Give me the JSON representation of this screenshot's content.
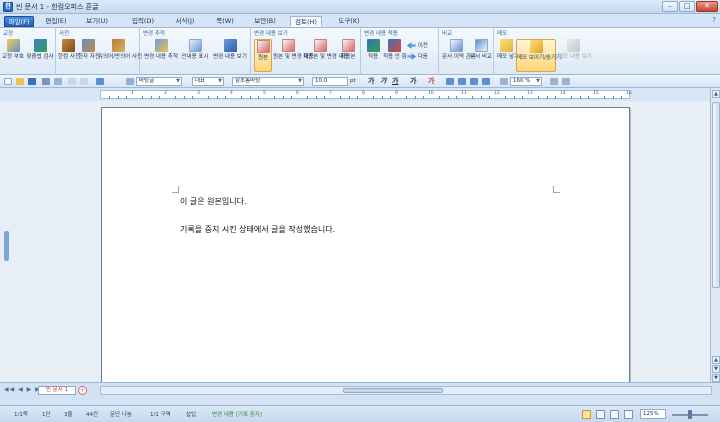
{
  "window": {
    "title": "빈 문서 1 - 한컴오피스 흔글",
    "buttons": {
      "minimize": "–",
      "maximize": "□",
      "close": "✕"
    }
  },
  "menu": {
    "tabs": [
      "파일(F)",
      "편집(E)",
      "보기(U)",
      "입력(D)",
      "서식(J)",
      "쪽(W)",
      "보안(B)",
      "검토(H)",
      "도구(K)"
    ],
    "active_index": 7,
    "help": "?"
  },
  "ribbon": {
    "groups": {
      "proof": {
        "label": "교정",
        "buttons": [
          "교정 부호",
          "맞춤법 검사"
        ]
      },
      "dictionary": {
        "label": "사전",
        "buttons": [
          "한컴 사전",
          "한자 자전",
          "유의어/반의어 사전"
        ]
      },
      "change_track": {
        "label": "변경 추적",
        "buttons": [
          "변경 내용 추적",
          "안내용 표시",
          "변경 내용 보기"
        ]
      },
      "change_view": {
        "label": "변경 내용 보기",
        "buttons": [
          "원본",
          "원본 및 변경 내용",
          "최종본 및 변경 내용",
          "최종본"
        ]
      },
      "change_apply": {
        "label": "변경 내용 적용",
        "buttons": [
          "적용",
          "적용 안 함"
        ],
        "prev": "이전",
        "next": "다음"
      },
      "compare": {
        "label": "비교",
        "buttons": [
          "문서 이력 관리",
          "문서 비교"
        ]
      },
      "memo": {
        "label": "메모",
        "buttons": [
          "메모 넣기",
          "메모 보이기/숨기기",
          "메모 내용 보기"
        ]
      }
    },
    "selected": [
      "원본",
      "메모 보이기/숨기기"
    ]
  },
  "format_toolbar": {
    "style": "바탕글",
    "language": "대표",
    "font": "함초롬바탕",
    "size": "10.0",
    "unit": "pt",
    "glyphs": [
      "가",
      "가",
      "가",
      "가",
      "가"
    ],
    "zoom": "160 %"
  },
  "document": {
    "lines": [
      "이 글은 원본입니다.",
      "기록을 중지 시킨 상태에서 글을 작성했습니다."
    ]
  },
  "doc_tabs": {
    "nav": "◀◀ ◀ ▶ ▶▶",
    "active": "빈 문서 1",
    "add": "+"
  },
  "ruler": {
    "labels": [
      "1",
      "2",
      "3",
      "4",
      "5",
      "6",
      "7",
      "8",
      "9",
      "10",
      "11",
      "12",
      "13",
      "14",
      "15",
      "16"
    ]
  },
  "status": {
    "page": "1/1쪽",
    "section": "1단",
    "line": "3줄",
    "column": "44칸",
    "word_mode": "문단 나눔",
    "region": "1/1 구역",
    "insert": "삽입",
    "track": "변경 내용 [기록 중지]",
    "zoom": "125%"
  }
}
